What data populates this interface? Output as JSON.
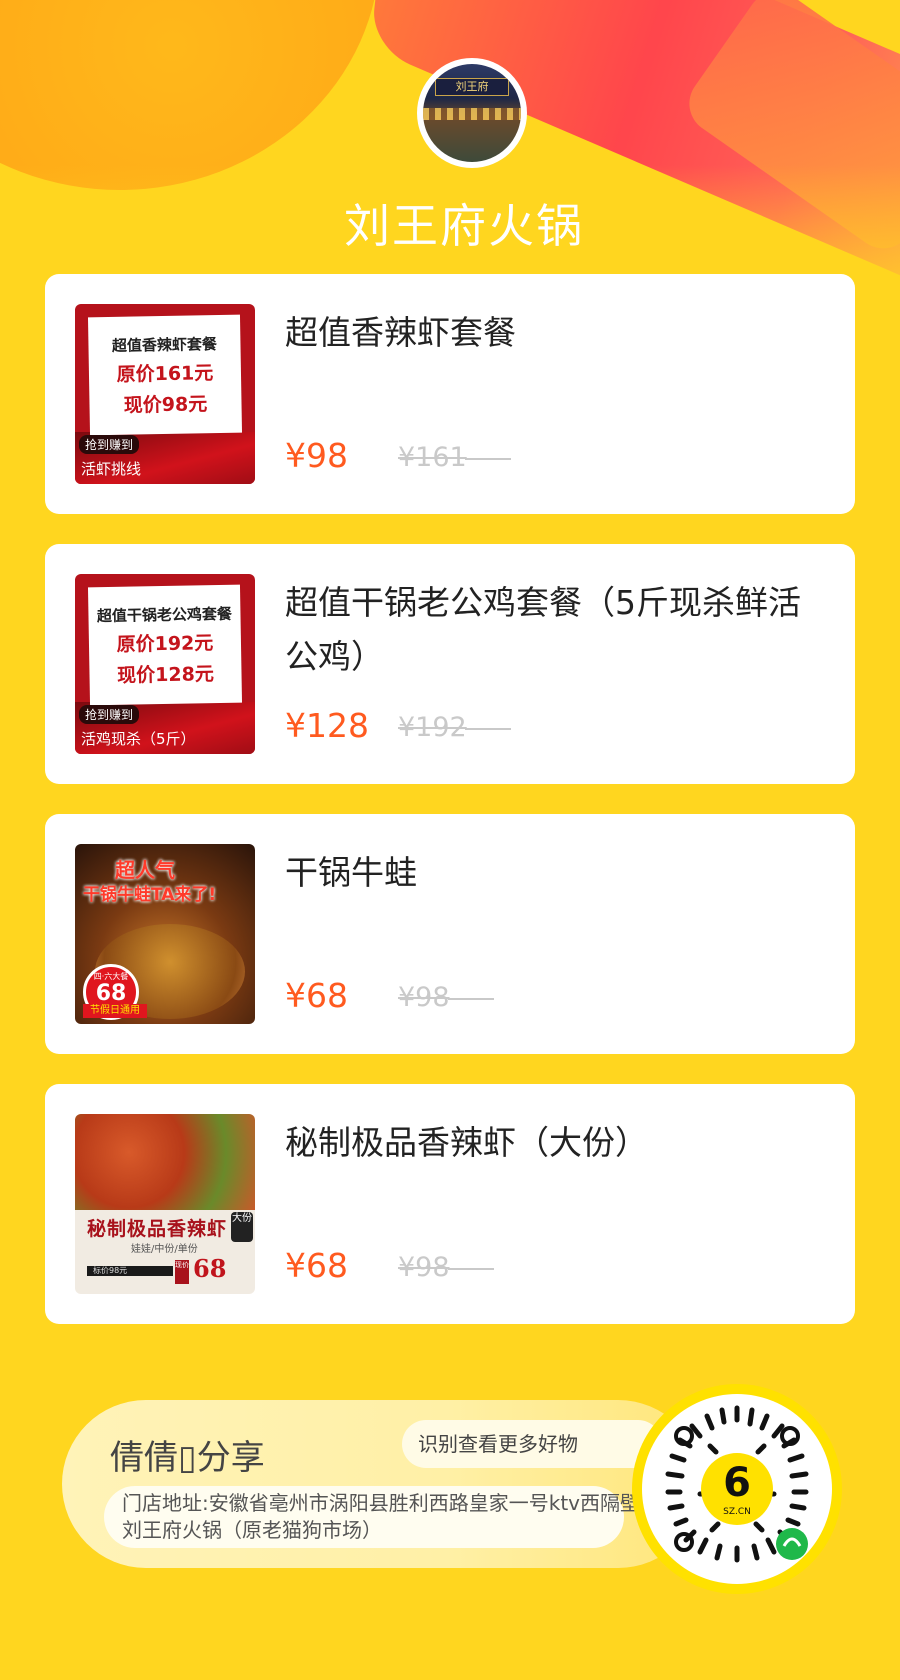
{
  "store": {
    "name": "刘王府火锅",
    "avatar_sign": "刘王府"
  },
  "products": [
    {
      "name": "超值香辣虾套餐",
      "price": "¥98",
      "original_price": "¥161",
      "thumb": {
        "line1": "超值香辣虾套餐",
        "line2": "原价161元",
        "line3": "现价98元",
        "tag1": "抢到赚到",
        "tag2": "活虾挑线"
      }
    },
    {
      "name": "超值干锅老公鸡套餐（5斤现杀鲜活公鸡）",
      "price": "¥128",
      "original_price": "¥192",
      "thumb": {
        "line1": "超值干锅老公鸡套餐",
        "line2": "原价192元",
        "line3": "现价128元",
        "tag1": "抢到赚到",
        "tag2": "活鸡现杀（5斤）"
      }
    },
    {
      "name": "干锅牛蛙",
      "price": "¥68",
      "original_price": "¥98",
      "thumb": {
        "headline1": "超人气",
        "headline2": "干锅牛蛙TA来了!",
        "badge_small": "四·六大餐",
        "badge_price": "68",
        "holiday": "节假日通用"
      }
    },
    {
      "name": "秘制极品香辣虾（大份）",
      "price": "¥68",
      "original_price": "¥98",
      "thumb": {
        "title": "秘制极品香辣虾",
        "subtitle": "娃娃/中份/单份",
        "bar": "标价98元",
        "box": "现价",
        "price": "68",
        "seal": "大份"
      }
    }
  ],
  "footer": {
    "sharer": "倩倩▯分享",
    "bubble": "识别查看更多好物",
    "address": "门店地址:安徽省亳州市涡阳县胜利西路皇家一号ktv西隔壁刘王府火锅（原老猫狗市场）",
    "qr_brand": "SZ.CN"
  },
  "colors": {
    "background": "#ffd61f",
    "price": "#ff5a1f",
    "strike": "#c9c9c9",
    "qr_ring": "#ffe100"
  }
}
